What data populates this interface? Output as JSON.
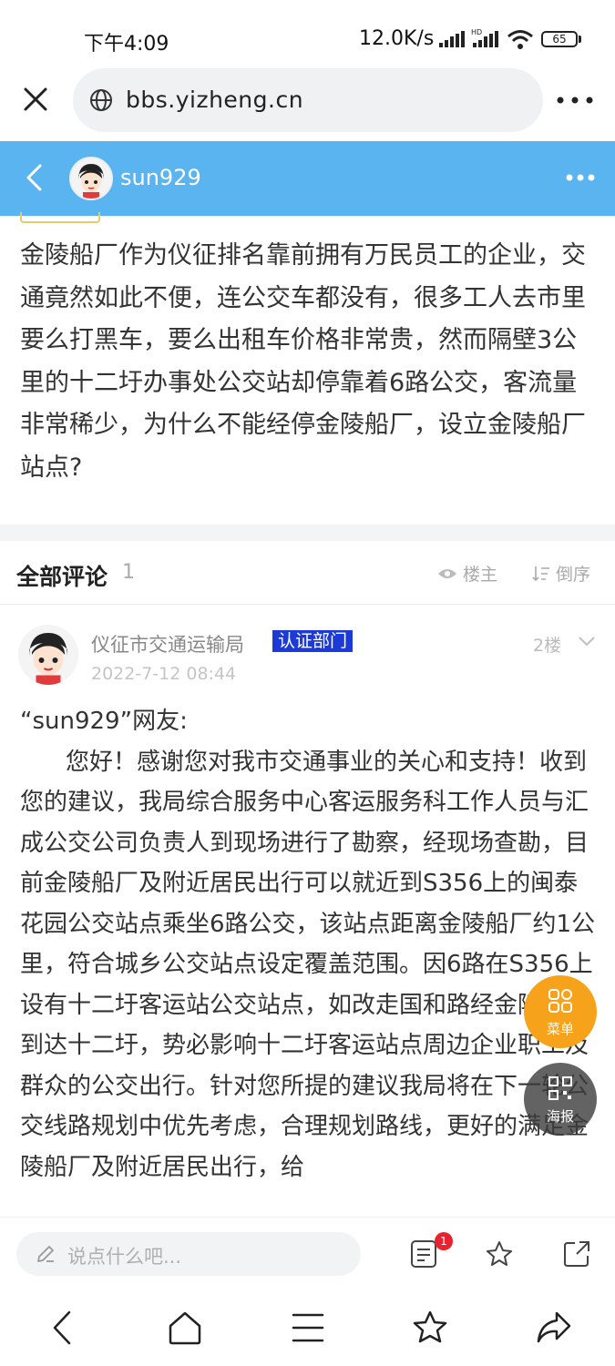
{
  "status_bar": {
    "time": "下午4:09",
    "net_speed": "12.0K/s",
    "battery": "65"
  },
  "browser": {
    "url": "bbs.yizheng.cn"
  },
  "header": {
    "username": "sun929"
  },
  "post": {
    "content": "金陵船厂作为仪征排名靠前拥有万民员工的企业，交通竟然如此不便，连公交车都没有，很多工人去市里要么打黑车，要么出租车价格非常贵，然而隔壁3公里的十二圩办事处公交站却停靠着6路公交，客流量非常稀少，为什么不能经停金陵船厂，设立金陵船厂站点?"
  },
  "comments_header": {
    "title": "全部评论",
    "count": "1",
    "filter_owner": "楼主",
    "sort_reverse": "倒序"
  },
  "comment": {
    "author": "仪征市交通运输局",
    "badge": "认证部门",
    "floor": "2楼",
    "date": "2022-7-12 08:44",
    "greeting": "“sun929”网友:",
    "body": "您好！感谢您对我市交通事业的关心和支持！收到您的建议，我局综合服务中心客运服务科工作人员与汇成公交公司负责人到现场进行了勘察，经现场查勘，目前金陵船厂及附近居民出行可以就近到S356上的闽泰花园公交站点乘坐6路公交，该站点距离金陵船厂约1公里，符合城乡公交站点设定覆盖范围。因6路在S356上设有十二圩客运站公交站点，如改走国和路经金陵船厂到达十二圩，势必影响十二圩客运站点周边企业职工及群众的公交出行。针对您所提的建议我局将在下一轮公交线路规划中优先考虑，合理规划路线，更好的满足金陵船厂及附近居民出行，给"
  },
  "fab": {
    "menu_label": "菜单",
    "poster_label": "海报"
  },
  "comment_bar": {
    "placeholder": "说点什么吧...",
    "badge_count": "1"
  },
  "colors": {
    "header_blue": "#5ab4f0",
    "badge_blue": "#1c3ad6",
    "fab_orange": "#f7a21b",
    "notify_red": "#e8232f"
  }
}
